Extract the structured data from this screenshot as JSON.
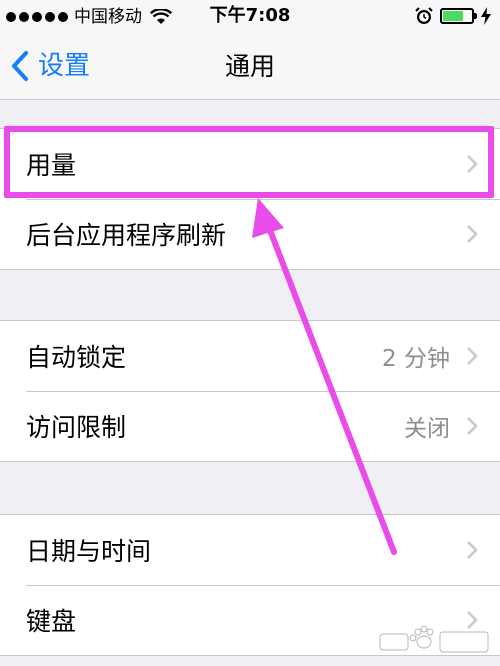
{
  "status_bar": {
    "carrier": "中国移动",
    "time": "下午7:08"
  },
  "nav": {
    "back_label": "设置",
    "title": "通用"
  },
  "groups": [
    {
      "items": [
        {
          "label": "用量",
          "value": ""
        },
        {
          "label": "后台应用程序刷新",
          "value": ""
        }
      ]
    },
    {
      "items": [
        {
          "label": "自动锁定",
          "value": "2 分钟"
        },
        {
          "label": "访问限制",
          "value": "关闭"
        }
      ]
    },
    {
      "items": [
        {
          "label": "日期与时间",
          "value": ""
        },
        {
          "label": "键盘",
          "value": ""
        }
      ]
    }
  ],
  "colors": {
    "accent": "#147efb",
    "annotation": "#e94ce9",
    "battery": "#4cd964"
  }
}
